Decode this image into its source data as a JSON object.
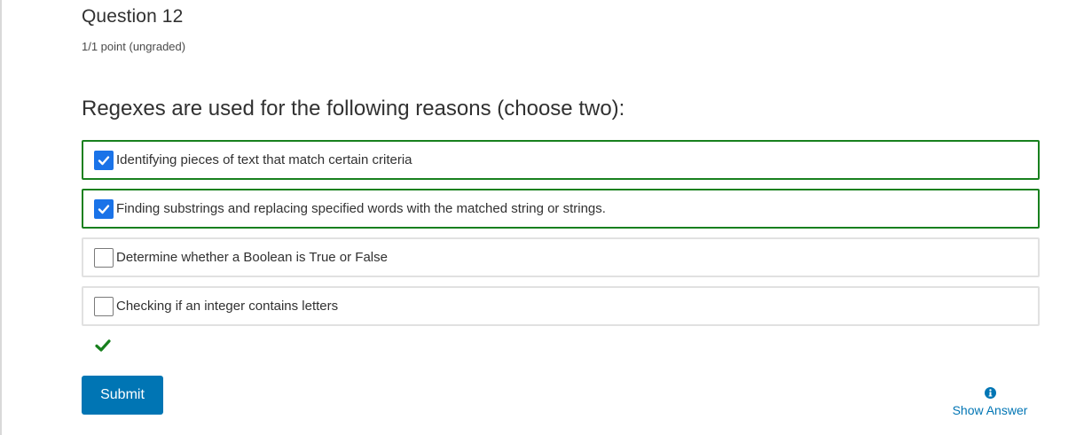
{
  "question": {
    "title": "Question 12",
    "points": "1/1 point (ungraded)",
    "prompt": "Regexes are used for the following reasons (choose two):"
  },
  "choices": [
    {
      "label": "Identifying pieces of text that match certain criteria",
      "checked": true
    },
    {
      "label": "Finding substrings and replacing specified words with the matched string or strings.",
      "checked": true
    },
    {
      "label": "Determine whether a Boolean is True or False",
      "checked": false
    },
    {
      "label": "Checking if an integer contains letters",
      "checked": false
    }
  ],
  "result": {
    "status": "correct",
    "icon": "checkmark-icon",
    "color": "#18801e"
  },
  "actions": {
    "submit_label": "Submit",
    "show_answer_label": "Show Answer",
    "show_answer_icon": "info-icon"
  },
  "colors": {
    "accent": "#0075b4",
    "checkbox_checked": "#1a73e8",
    "correct_border": "#18801e"
  }
}
